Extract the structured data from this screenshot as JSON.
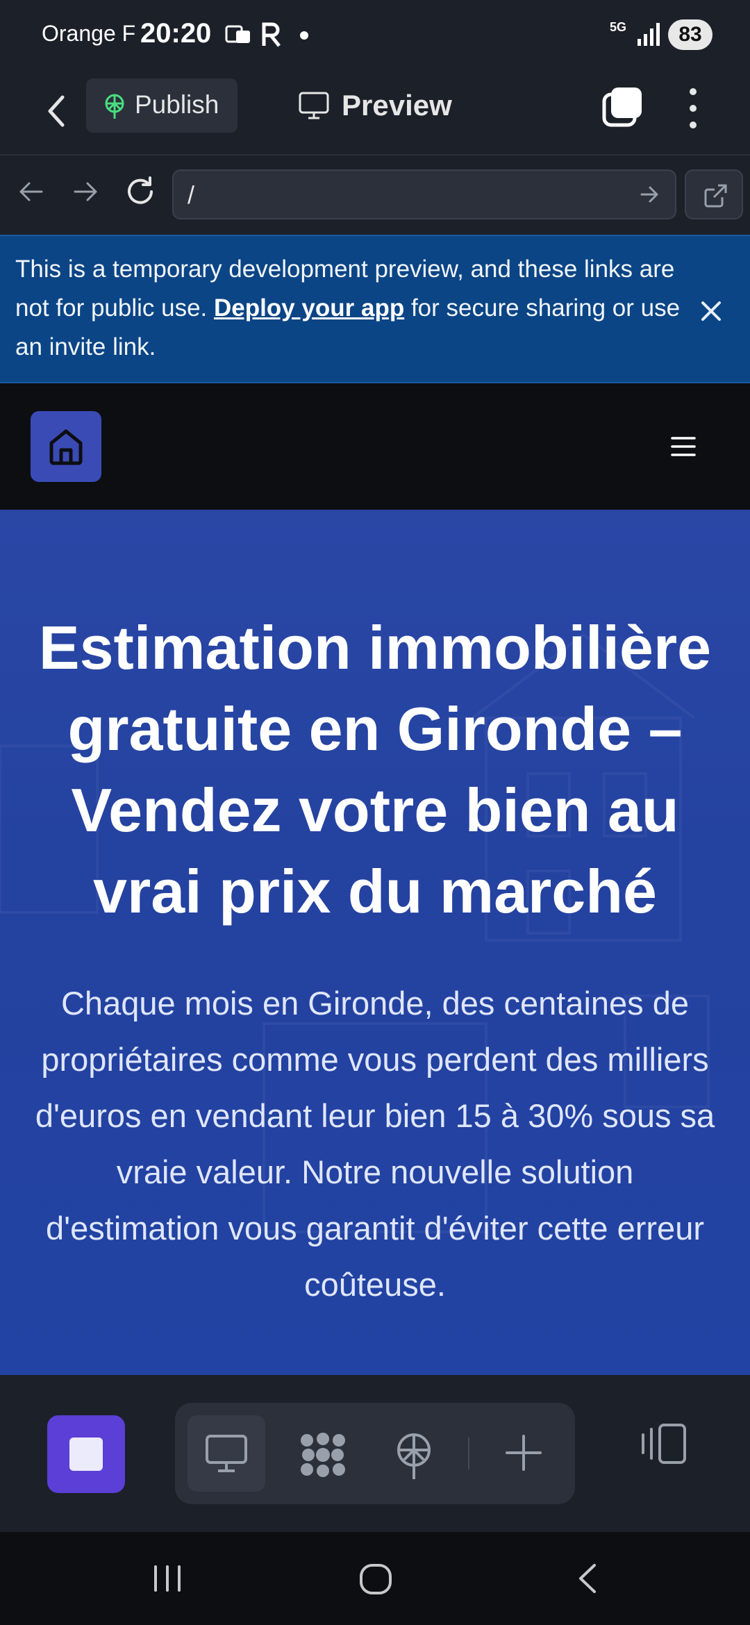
{
  "status_bar": {
    "carrier": "Orange F",
    "time": "20:20",
    "network": "5G",
    "battery": "83"
  },
  "app_header": {
    "publish_label": "Publish",
    "preview_label": "Preview"
  },
  "browser": {
    "url": "/"
  },
  "banner": {
    "text_before": "This is a temporary development preview, and these links are not for public use. ",
    "link_label": "Deploy your app",
    "text_after": " for secure sharing or use an invite link."
  },
  "hero": {
    "title": "Estimation immobilière gratuite en Gironde – Vendez votre bien au vrai prix du marché",
    "subtitle": "Chaque mois en Gironde, des centaines de propriétaires comme vous perdent des milliers d'euros en vendant leur bien 15 à 30% sous sa vraie valeur. Notre nouvelle solution d'estimation vous garantit d'éviter cette erreur coûteuse."
  },
  "colors": {
    "app_bg": "#1c2029",
    "banner_bg": "#0b4585",
    "hero_bg": "#2a47a6",
    "home_tile": "#3b4bb6",
    "stop_button": "#5b3fd6",
    "publish_icon": "#4ade80"
  },
  "icons": [
    "back-icon",
    "publish-icon",
    "monitor-icon",
    "tabs-icon",
    "kebab-icon",
    "arrow-left-icon",
    "arrow-right-icon",
    "reload-icon",
    "go-arrow-icon",
    "external-link-icon",
    "close-icon",
    "home-icon",
    "hamburger-icon",
    "stop-icon",
    "apps-grid-icon",
    "deploy-icon",
    "plus-icon",
    "panel-icon"
  ]
}
